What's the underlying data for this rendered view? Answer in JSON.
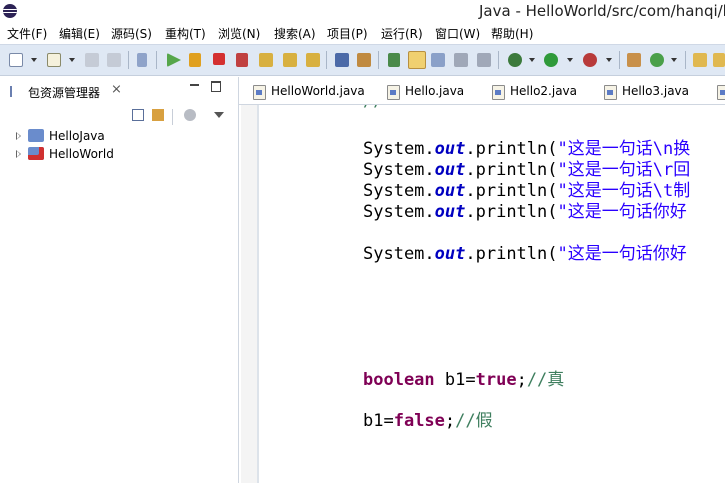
{
  "window": {
    "title": "Java - HelloWorld/src/com/hanqi/l"
  },
  "menu": [
    "文件(F)",
    "编辑(E)",
    "源码(S)",
    "重构(T)",
    "浏览(N)",
    "搜索(A)",
    "项目(P)",
    "运行(R)",
    "窗口(W)",
    "帮助(H)"
  ],
  "explorer": {
    "title": "包资源管理器",
    "close_glyph": "⨯",
    "projects": [
      "HelloJava",
      "HelloWorld"
    ]
  },
  "editor": {
    "tabs": [
      "HelloWorld.java",
      "Hello.java",
      "Hello2.java",
      "Hello3.java"
    ],
    "code": {
      "l1": {
        "a": "System.",
        "b": "out",
        "c": ".println(",
        "d": "\"这是一句话\\n换"
      },
      "l2": {
        "a": "System.",
        "b": "out",
        "c": ".println(",
        "d": "\"这是一句话\\r回"
      },
      "l3": {
        "a": "System.",
        "b": "out",
        "c": ".println(",
        "d": "\"这是一句话\\t制"
      },
      "l4": {
        "a": "System.",
        "b": "out",
        "c": ".println(",
        "d": "\"这是一句话你好"
      },
      "l5": {
        "a": "System.",
        "b": "out",
        "c": ".println(",
        "d": "\"这是一句话你好"
      },
      "l6": {
        "a": "boolean",
        "b": " b1=",
        "c": "true",
        "d": ";",
        "e": "//真"
      },
      "l7": {
        "a": "b1=",
        "b": "false",
        "c": ";",
        "d": "//假"
      }
    }
  },
  "colors": {
    "toolbar_bg": "#dfe8f4",
    "keyword": "#7f0055",
    "string": "#2a00ff",
    "field": "#0000c0",
    "comment": "#3f7f5f"
  }
}
